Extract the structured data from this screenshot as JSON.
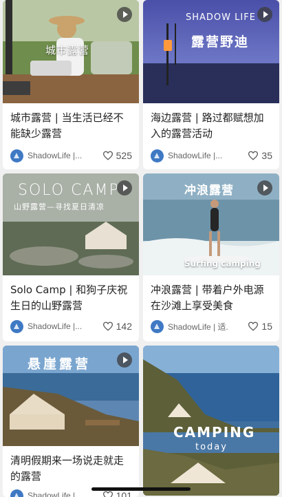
{
  "posts": [
    {
      "title": "城市露营 | 当生活已经不能缺少露营",
      "author": "ShadowLife |...",
      "likes": "525",
      "overlay": "城市露营",
      "video_icon": "play-icon"
    },
    {
      "title": "海边露营 | 路过都赋想加入的露营活动",
      "author": "ShadowLife |...",
      "likes": "35",
      "overlay_top": "SHADOW LIFE",
      "overlay": "露营野迪",
      "video_icon": "play-icon"
    },
    {
      "title": "Solo Camp | 和狗子庆祝生日的山野露营",
      "author": "ShadowLife |...",
      "likes": "142",
      "overlay_top": "SOLO CAMP",
      "overlay": "山野露营—寻找夏日清凉",
      "video_icon": "play-icon"
    },
    {
      "title": "冲浪露营 | 带着户外电源在沙滩上享受美食",
      "author": "ShadowLife | 适...",
      "likes": "15",
      "overlay": "冲浪露营",
      "overlay_bottom": "Surfing camping",
      "video_icon": "play-icon"
    },
    {
      "title": "清明假期来一场说走就走的露营",
      "author": "ShadowLife |...",
      "likes": "101",
      "overlay": "悬崖露营",
      "video_icon": "play-icon"
    },
    {
      "overlay": "CAMPING",
      "overlay_bottom": "today"
    }
  ],
  "colors": {
    "avatar": "#3f79c4",
    "background": "#f0f0f0"
  }
}
